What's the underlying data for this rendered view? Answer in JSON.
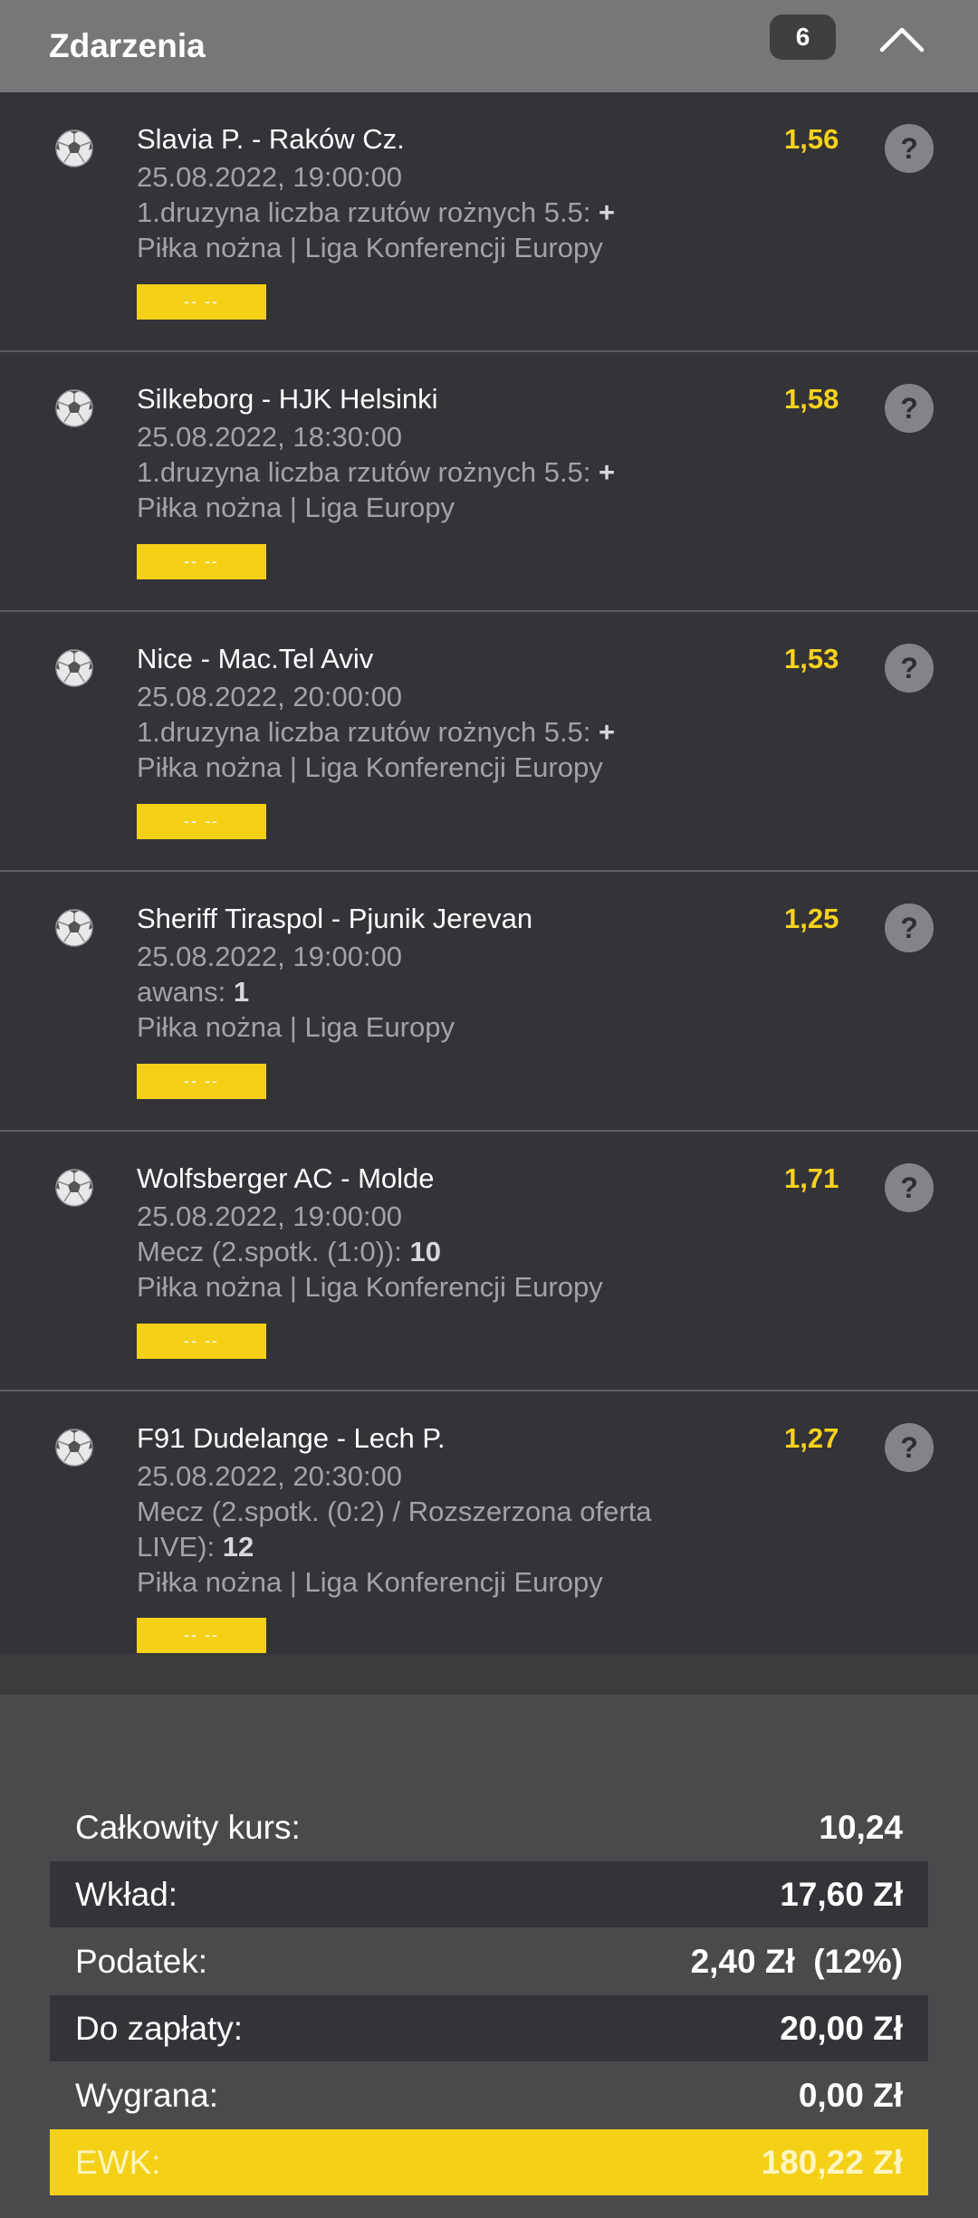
{
  "header": {
    "title": "Zdarzenia",
    "count": "6"
  },
  "events": [
    {
      "teams": "Slavia P. - Raków Cz.",
      "odd": "1,56",
      "date": "25.08.2022, 19:00:00",
      "bet_label": "1.druzyna liczba rzutów rożnych 5.5:",
      "bet_value": "+",
      "bet_label_2": "",
      "bet_value_2": "",
      "league": "Piłka nożna | Liga Konferencji Europy",
      "tag": "-- --"
    },
    {
      "teams": "Silkeborg - HJK Helsinki",
      "odd": "1,58",
      "date": "25.08.2022, 18:30:00",
      "bet_label": "1.druzyna liczba rzutów rożnych 5.5:",
      "bet_value": "+",
      "bet_label_2": "",
      "bet_value_2": "",
      "league": "Piłka nożna | Liga Europy",
      "tag": "-- --"
    },
    {
      "teams": "Nice - Mac.Tel Aviv",
      "odd": "1,53",
      "date": "25.08.2022, 20:00:00",
      "bet_label": "1.druzyna liczba rzutów rożnych 5.5:",
      "bet_value": "+",
      "bet_label_2": "",
      "bet_value_2": "",
      "league": "Piłka nożna | Liga Konferencji Europy",
      "tag": "-- --"
    },
    {
      "teams": "Sheriff Tiraspol - Pjunik Jerevan",
      "odd": "1,25",
      "date": "25.08.2022, 19:00:00",
      "bet_label": "awans:",
      "bet_value": "1",
      "bet_label_2": "",
      "bet_value_2": "",
      "league": "Piłka nożna | Liga Europy",
      "tag": "-- --"
    },
    {
      "teams": "Wolfsberger AC - Molde",
      "odd": "1,71",
      "date": "25.08.2022, 19:00:00",
      "bet_label": "Mecz (2.spotk. (1:0)):",
      "bet_value": "10",
      "bet_label_2": "",
      "bet_value_2": "",
      "league": "Piłka nożna | Liga Konferencji Europy",
      "tag": "-- --"
    },
    {
      "teams": "F91 Dudelange - Lech P.",
      "odd": "1,27",
      "date": "25.08.2022, 20:30:00",
      "bet_label": "Mecz (2.spotk. (0:2) / Rozszerzona oferta",
      "bet_value": "",
      "bet_label_2": "LIVE):",
      "bet_value_2": "12",
      "league": "Piłka nożna | Liga Konferencji Europy",
      "tag": "-- --"
    }
  ],
  "summary": {
    "total_odds_label": "Całkowity kurs:",
    "total_odds_value": "10,24",
    "stake_label": "Wkład:",
    "stake_value": "17,60 Zł",
    "tax_label": "Podatek:",
    "tax_value": "2,40 Zł  (12%)",
    "to_pay_label": "Do zapłaty:",
    "to_pay_value": "20,00 Zł",
    "win_label": "Wygrana:",
    "win_value": "0,00 Zł",
    "ewk_label": "EWK:",
    "ewk_value": "180,22 Zł"
  },
  "colors": {
    "accent_yellow": "#f4d017",
    "odd_yellow": "#f7d21c",
    "panel_dark": "#333338",
    "header_gray": "#77777a"
  },
  "icons": {
    "collapse": "chevron-up-icon",
    "sport": "soccer-ball-icon",
    "help": "question-icon"
  }
}
